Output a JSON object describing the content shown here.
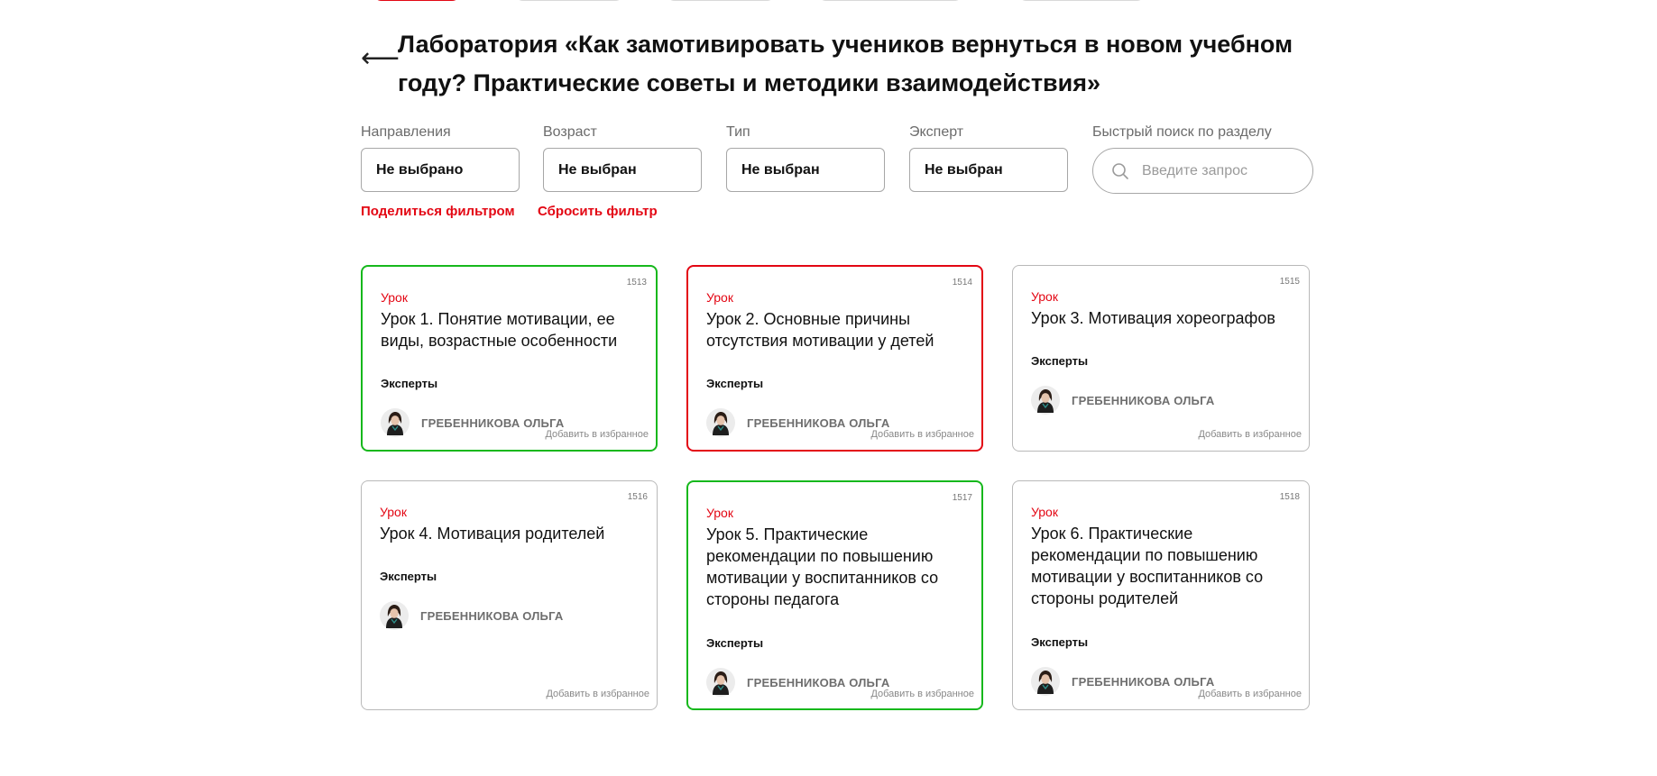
{
  "header": {
    "back_arrow": "⟵",
    "title": "Лаборатория «Как замотивировать учеников вернуться в новом учебном году? Практические советы и методики взаимодействия»"
  },
  "filters": {
    "directions": {
      "label": "Направления",
      "value": "Не выбрано"
    },
    "age": {
      "label": "Возраст",
      "value": "Не выбран"
    },
    "type": {
      "label": "Тип",
      "value": "Не выбран"
    },
    "expert": {
      "label": "Эксперт",
      "value": "Не выбран"
    },
    "search": {
      "label": "Быстрый поиск по разделу",
      "placeholder": "Введите запрос"
    },
    "share_label": "Поделиться фильтром",
    "reset_label": "Сбросить фильтр"
  },
  "colors": {
    "accent_red": "#e30613",
    "active_green": "#16b81c",
    "border_gray": "#b9b9b9"
  },
  "cards": [
    {
      "id": "1513",
      "type": "Урок",
      "title": "Урок 1. Понятие мотивации, ее виды, возрастные особенности",
      "experts_label": "Эксперты",
      "expert_name": "ГРЕБЕННИКОВА ОЛЬГА",
      "favorite_label": "Добавить в избранное",
      "status": "green"
    },
    {
      "id": "1514",
      "type": "Урок",
      "title": "Урок 2. Основные причины отсутствия мотивации у детей",
      "experts_label": "Эксперты",
      "expert_name": "ГРЕБЕННИКОВА ОЛЬГА",
      "favorite_label": "Добавить в избранное",
      "status": "red"
    },
    {
      "id": "1515",
      "type": "Урок",
      "title": "Урок 3. Мотивация хореографов",
      "experts_label": "Эксперты",
      "expert_name": "ГРЕБЕННИКОВА ОЛЬГА",
      "favorite_label": "Добавить в избранное",
      "status": "default"
    },
    {
      "id": "1516",
      "type": "Урок",
      "title": "Урок 4. Мотивация родителей",
      "experts_label": "Эксперты",
      "expert_name": "ГРЕБЕННИКОВА ОЛЬГА",
      "favorite_label": "Добавить в избранное",
      "status": "default"
    },
    {
      "id": "1517",
      "type": "Урок",
      "title": "Урок 5. Практические рекомендации по повышению мотивации у воспитанников со стороны педагога",
      "experts_label": "Эксперты",
      "expert_name": "ГРЕБЕННИКОВА ОЛЬГА",
      "favorite_label": "Добавить в избранное",
      "status": "green"
    },
    {
      "id": "1518",
      "type": "Урок",
      "title": "Урок 6. Практические рекомендации по повышению мотивации у воспитанников со стороны родителей",
      "experts_label": "Эксперты",
      "expert_name": "ГРЕБЕННИКОВА ОЛЬГА",
      "favorite_label": "Добавить в избранное",
      "status": "default"
    }
  ]
}
